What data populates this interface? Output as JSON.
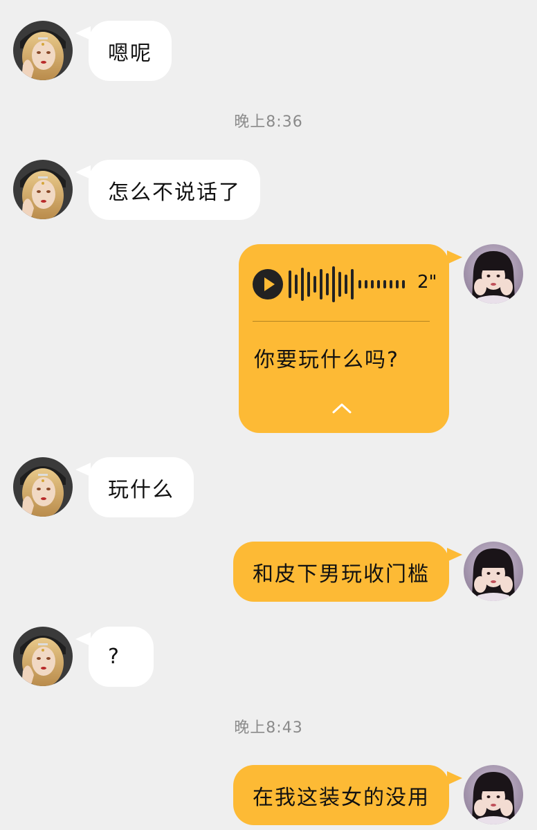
{
  "messages": [
    {
      "side": "left",
      "text": "嗯呢"
    },
    {
      "type": "time",
      "text": "晚上8:36"
    },
    {
      "side": "left",
      "text": "怎么不说话了"
    },
    {
      "side": "right",
      "type": "voice",
      "duration": "2\"",
      "transcript": "你要玩什么吗?"
    },
    {
      "side": "left",
      "text": "玩什么"
    },
    {
      "side": "right",
      "text": "和皮下男玩收门槛"
    },
    {
      "side": "left",
      "text": "?"
    },
    {
      "type": "time",
      "text": "晚上8:43"
    },
    {
      "side": "right",
      "text": "在我这装女的没用"
    }
  ],
  "colors": {
    "background": "#efefef",
    "left_bubble": "#ffffff",
    "right_bubble": "#fdba35"
  },
  "icons": {
    "play": "play-icon",
    "collapse": "chevron-up-icon",
    "waveform": "voice-waveform-icon"
  }
}
